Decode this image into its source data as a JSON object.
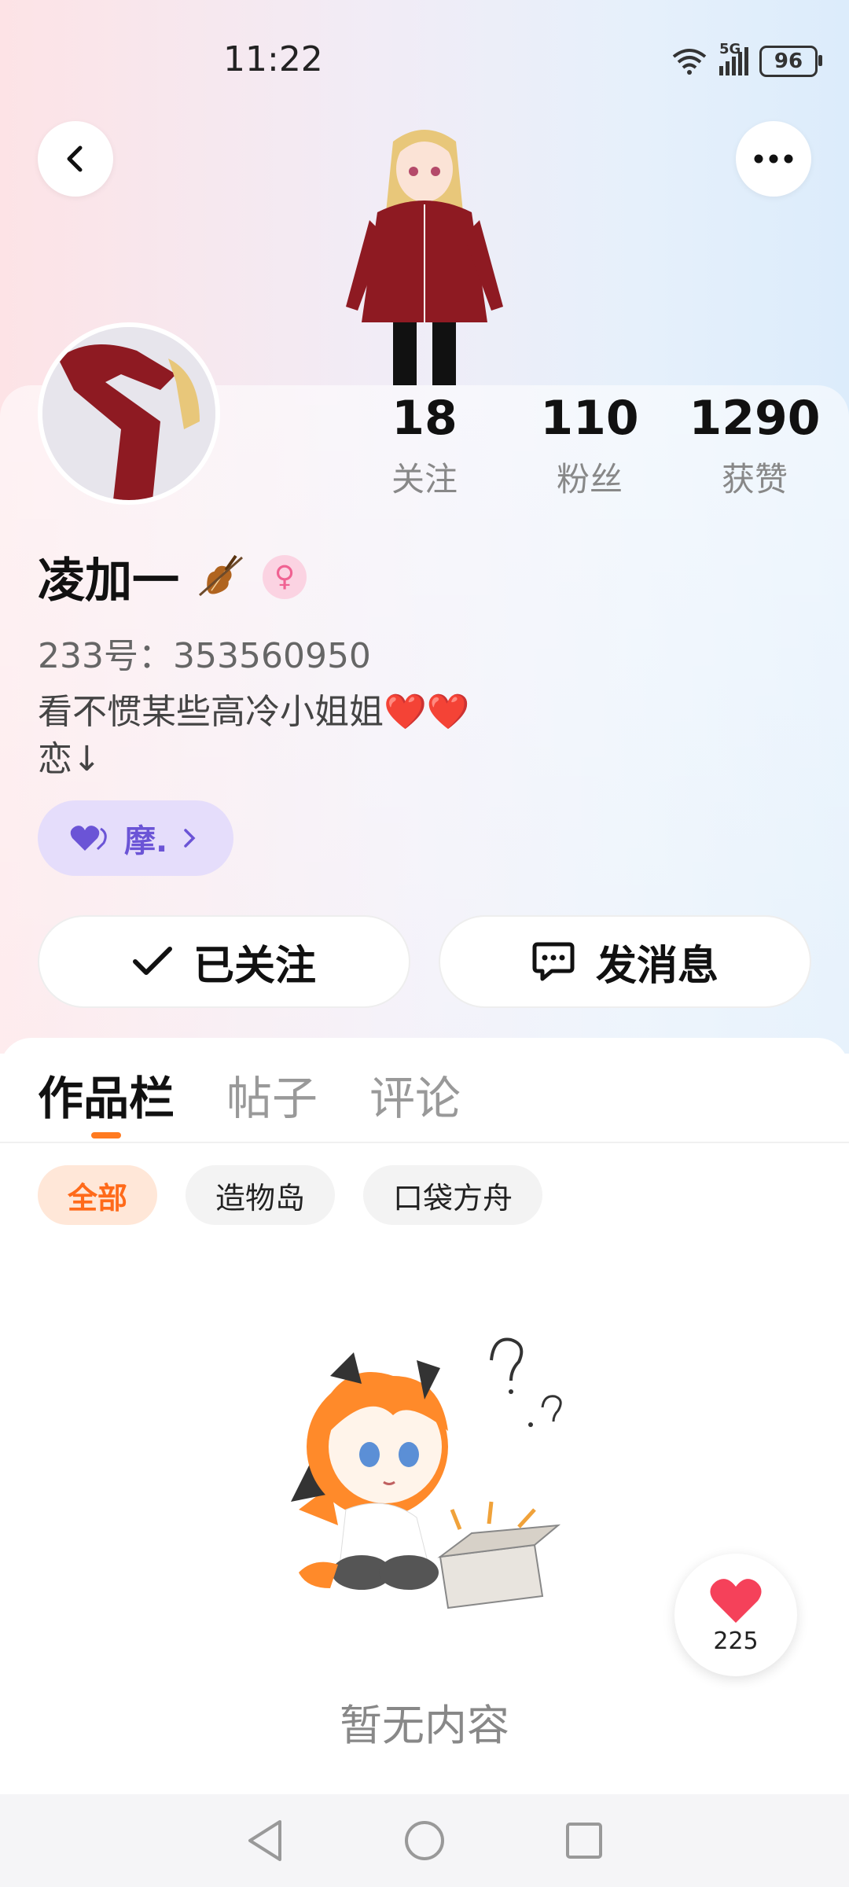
{
  "status_bar": {
    "time": "11:22",
    "network": "5G",
    "battery": "96",
    "icons": [
      "wifi-icon",
      "signal-icon",
      "battery-icon"
    ]
  },
  "header": {
    "back_icon": "chevron-left-icon",
    "more_icon": "more-horizontal-icon"
  },
  "profile": {
    "stats": [
      {
        "value": "18",
        "label": "关注"
      },
      {
        "value": "110",
        "label": "粉丝"
      },
      {
        "value": "1290",
        "label": "获赞"
      }
    ],
    "username": "凌加一",
    "username_emoji": "violin-icon",
    "gender_icon": "female-icon",
    "id_line": "233号：353560950",
    "bio": "看不惯某些高冷小姐姐❤️❤️\n恋↓",
    "tag_label": "摩."
  },
  "actions": {
    "follow_label": "已关注",
    "message_label": "发消息"
  },
  "tabs": [
    "作品栏",
    "帖子",
    "评论"
  ],
  "active_tab": "作品栏",
  "filters": [
    "全部",
    "造物岛",
    "口袋方舟"
  ],
  "active_filter": "全部",
  "empty_state": {
    "text": "暂无内容"
  },
  "like_button": {
    "count": "225",
    "icon": "heart-icon"
  },
  "colors": {
    "accent": "#ff7a20",
    "tag_bg": "#e5ddfb",
    "tag_text": "#6b54d6",
    "heart": "#f5415a"
  }
}
